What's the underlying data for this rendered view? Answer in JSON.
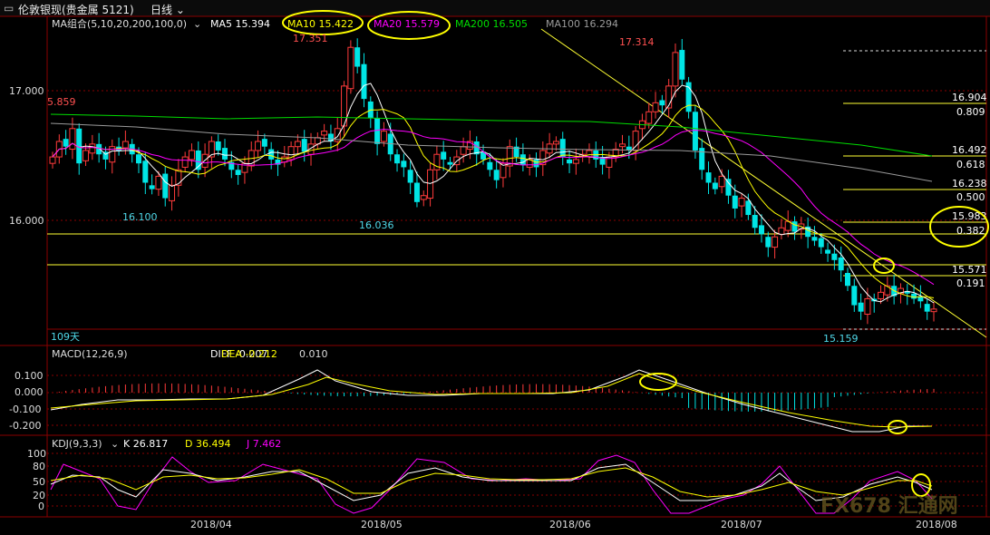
{
  "window": {
    "title": "伦敦银现(贵金属 5121)",
    "period": "日线"
  },
  "colors": {
    "up": "#ff3b3b",
    "down": "#00e5e5",
    "ma5": "#ffffff",
    "ma10": "#ffff00",
    "ma20": "#ff00ff",
    "ma200": "#00dd00",
    "ma100": "#9a9a9a",
    "grid": "#8a0000",
    "fib": "#ffff33",
    "annotation": "#ffff00"
  },
  "legend": {
    "ma_group": "MA组合(5,10,20,200,100,0)",
    "ma5": "MA5 15.394",
    "ma10": "MA10 15.422",
    "ma20": "MA20 15.579",
    "ma200": "MA200 16.505",
    "ma100": "MA100 16.294"
  },
  "price_axis": {
    "ticks": [
      "17.000",
      "16.000"
    ]
  },
  "price_annotations": {
    "left": "5.859",
    "high1": "17.351",
    "high2": "17.314",
    "low1": "16.100",
    "low2": "16.036",
    "low3": "15.159",
    "days": "109天"
  },
  "fibonacci": [
    {
      "price": "16.904",
      "ratio": "0.809"
    },
    {
      "price": "16.492",
      "ratio": "0.618"
    },
    {
      "price": "16.238",
      "ratio": "0.500"
    },
    {
      "price": "15.983",
      "ratio": "0.382"
    },
    {
      "price": "15.571",
      "ratio": "0.191"
    }
  ],
  "macd": {
    "label": "MACD(12,26,9)",
    "diff": "DIFF -0.207",
    "dea": "DEA -0.212",
    "macd": "0.010",
    "ticks": [
      "0.100",
      "0.000",
      "-0.100",
      "-0.200"
    ]
  },
  "kdj": {
    "label": "KDJ(9,3,3)",
    "k": "K 26.817",
    "d": "D 36.494",
    "j": "J 7.462",
    "ticks": [
      "100",
      "80",
      "50",
      "20",
      "0"
    ]
  },
  "x_axis": {
    "labels": [
      "2018/04",
      "2018/05",
      "2018/06",
      "2018/07",
      "2018/08"
    ]
  },
  "watermark": "FX678 汇通网",
  "chart_data": {
    "type": "candlestick",
    "title": "伦敦银现(贵金属 5121) 日线",
    "x_range": [
      "2018/03",
      "2018/08"
    ],
    "ylim": [
      15.15,
      17.45
    ],
    "close_series": [
      16.5,
      16.62,
      16.58,
      16.72,
      16.45,
      16.55,
      16.6,
      16.52,
      16.48,
      16.58,
      16.55,
      16.62,
      16.52,
      16.45,
      16.3,
      16.25,
      16.35,
      16.18,
      16.28,
      16.4,
      16.5,
      16.55,
      16.4,
      16.52,
      16.62,
      16.55,
      16.48,
      16.4,
      16.36,
      16.45,
      16.55,
      16.62,
      16.58,
      16.48,
      16.44,
      16.5,
      16.58,
      16.62,
      16.54,
      16.6,
      16.65,
      16.7,
      16.62,
      16.72,
      17.05,
      17.35,
      17.2,
      16.95,
      16.8,
      16.6,
      16.7,
      16.52,
      16.45,
      16.42,
      16.3,
      16.15,
      16.2,
      16.4,
      16.52,
      16.48,
      16.44,
      16.5,
      16.58,
      16.62,
      16.52,
      16.48,
      16.4,
      16.32,
      16.45,
      16.58,
      16.5,
      16.44,
      16.48,
      16.42,
      16.55,
      16.6,
      16.62,
      16.5,
      16.45,
      16.48,
      16.52,
      16.55,
      16.48,
      16.44,
      16.5,
      16.56,
      16.6,
      16.55,
      16.7,
      16.78,
      16.85,
      16.92,
      16.9,
      17.05,
      17.31,
      17.1,
      16.85,
      16.55,
      16.4,
      16.3,
      16.25,
      16.35,
      16.2,
      16.1,
      16.18,
      16.05,
      15.95,
      15.9,
      15.8,
      15.88,
      15.95,
      16.0,
      15.92,
      15.98,
      15.88,
      15.85,
      15.8,
      15.75,
      15.7,
      15.62,
      15.5,
      15.35,
      15.3,
      15.4,
      15.38,
      15.45,
      15.5,
      15.42,
      15.48,
      15.44,
      15.4,
      15.38,
      15.3,
      15.32
    ]
  }
}
